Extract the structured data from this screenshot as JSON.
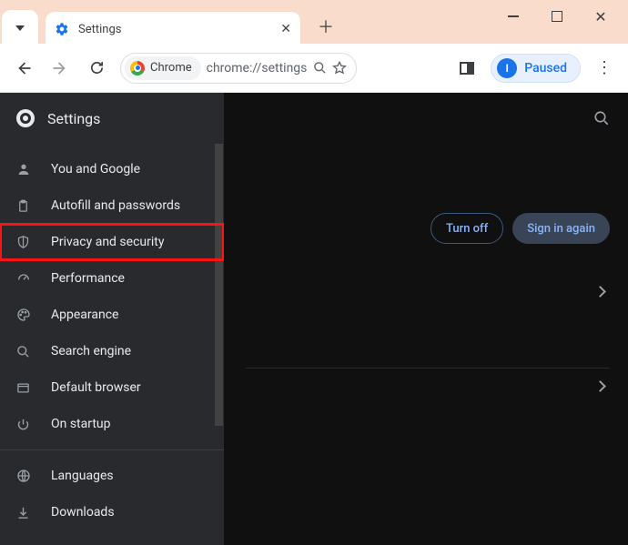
{
  "window": {
    "tab_title": "Settings",
    "tab_icon": "gear-icon",
    "paused_label": "Paused",
    "paused_initial": "I"
  },
  "toolbar": {
    "chip_label": "Chrome",
    "url": "chrome://settings"
  },
  "sidebar": {
    "header": "Settings",
    "items": [
      {
        "label": "You and Google"
      },
      {
        "label": "Autofill and passwords"
      },
      {
        "label": "Privacy and security"
      },
      {
        "label": "Performance"
      },
      {
        "label": "Appearance"
      },
      {
        "label": "Search engine"
      },
      {
        "label": "Default browser"
      },
      {
        "label": "On startup"
      }
    ],
    "more": [
      {
        "label": "Languages"
      },
      {
        "label": "Downloads"
      }
    ],
    "highlighted_index": 2
  },
  "content": {
    "turn_off_label": "Turn off",
    "sign_in_again_label": "Sign in again"
  }
}
